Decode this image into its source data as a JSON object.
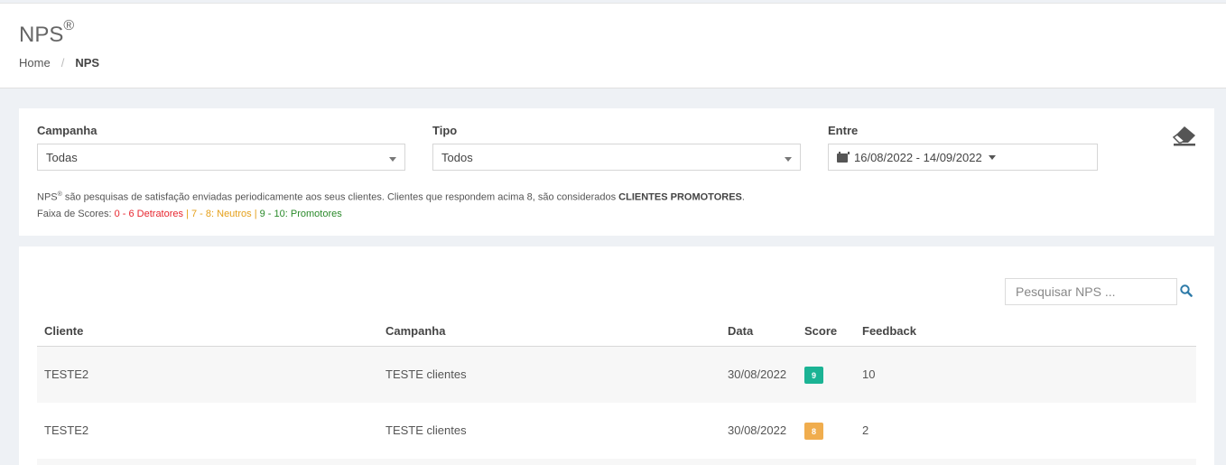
{
  "header": {
    "title": "NPS",
    "title_mark": "®",
    "breadcrumb": {
      "home": "Home",
      "separator": "/",
      "current": "NPS"
    }
  },
  "filters": {
    "campanha": {
      "label": "Campanha",
      "value": "Todas"
    },
    "tipo": {
      "label": "Tipo",
      "value": "Todos"
    },
    "entre": {
      "label": "Entre",
      "value": "16/08/2022 - 14/09/2022"
    },
    "clear_icon": "eraser-icon"
  },
  "info": {
    "line1_prefix": "NPS",
    "line1_mark": "®",
    "line1_text": " são pesquisas de satisfação enviadas periodicamente aos seus clientes. Clientes que respondem acima 8, são considerados ",
    "line1_bold": "CLIENTES PROMOTORES",
    "line1_end": ".",
    "line2_prefix": "Faixa de Scores: ",
    "detratores": "0 - 6 Detratores",
    "neutros": "7 - 8: Neutros",
    "promotores": "9 - 10: Promotores",
    "sep": " | "
  },
  "search": {
    "placeholder": "Pesquisar NPS ...",
    "icon": "search-icon"
  },
  "table": {
    "headers": {
      "cliente": "Cliente",
      "campanha": "Campanha",
      "data": "Data",
      "score": "Score",
      "feedback": "Feedback"
    },
    "rows": [
      {
        "cliente": "TESTE2",
        "campanha": "TESTE clientes",
        "data": "30/08/2022",
        "score": "9",
        "feedback": "10"
      },
      {
        "cliente": "TESTE2",
        "campanha": "TESTE clientes",
        "data": "30/08/2022",
        "score": "8",
        "feedback": "2"
      }
    ]
  },
  "colors": {
    "promoter_badge": "#1bb394",
    "neutral_badge": "#f0ad4e",
    "detractor_text": "#e7262f",
    "neutral_text": "#e5a01a",
    "promoter_text": "#2a8a2a",
    "link_accent": "#2d7aa8"
  }
}
